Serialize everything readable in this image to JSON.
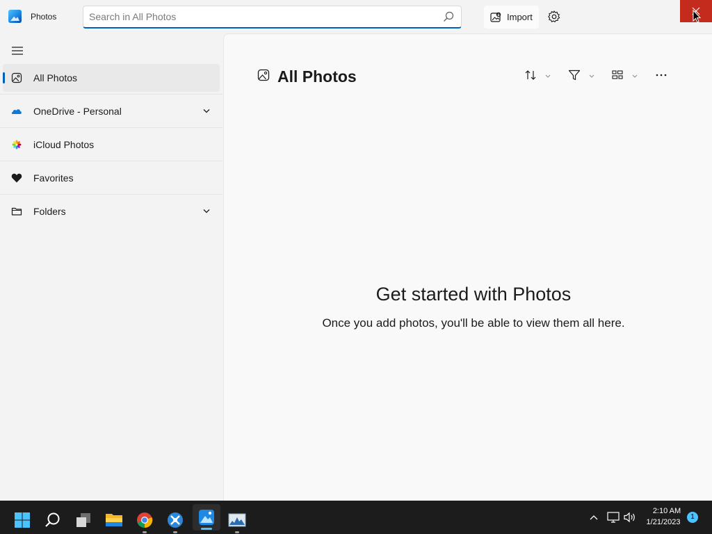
{
  "titlebar": {
    "app_title": "Photos",
    "search_placeholder": "Search in All Photos",
    "search_value": "",
    "import_label": "Import",
    "accent": "#005fb8",
    "close_color": "#c42b1c"
  },
  "sidebar": {
    "items": [
      {
        "label": "All Photos",
        "icon": "photo-icon",
        "active": true
      },
      {
        "label": "OneDrive - Personal",
        "icon": "onedrive-icon",
        "expandable": true
      },
      {
        "label": "iCloud Photos",
        "icon": "icloud-icon"
      },
      {
        "label": "Favorites",
        "icon": "heart-icon"
      },
      {
        "label": "Folders",
        "icon": "folder-icon",
        "expandable": true
      }
    ]
  },
  "main": {
    "title": "All Photos",
    "toolbar": [
      "sort-icon",
      "filter-icon",
      "view-icon",
      "more-icon"
    ],
    "empty_title": "Get started with Photos",
    "empty_subtitle": "Once you add photos, you'll be able to view them all here."
  },
  "taskbar": {
    "apps": [
      "start-icon",
      "search-icon",
      "task-view-icon",
      "file-explorer-icon",
      "chrome-icon",
      "app-icon",
      "photos-icon",
      "task-manager-icon"
    ],
    "time": "2:10 AM",
    "date": "1/21/2023",
    "notification_count": "1"
  }
}
